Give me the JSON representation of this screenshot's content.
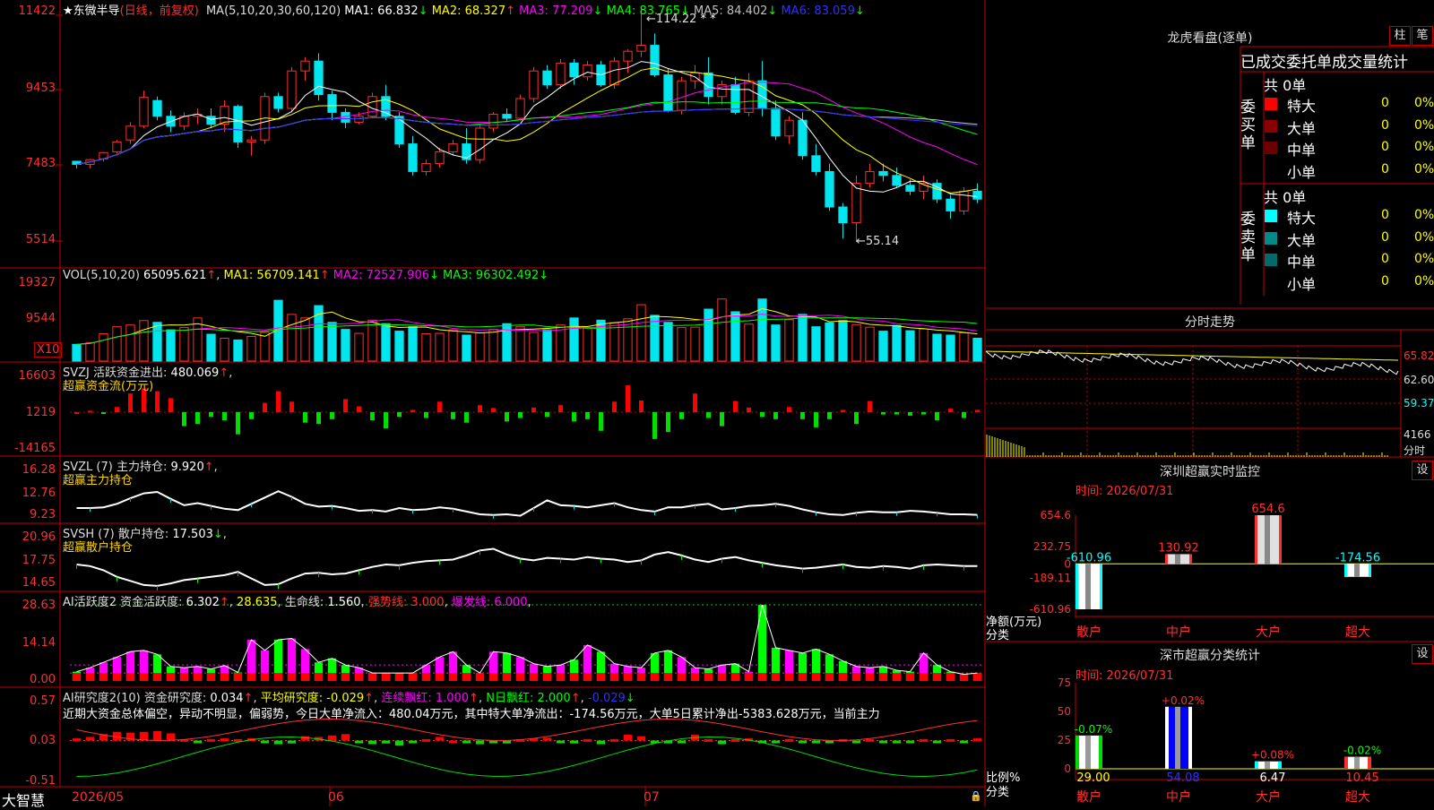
{
  "stock": {
    "star": "★",
    "name": "东微半导",
    "mode": "(日线，前复权)"
  },
  "price_panel": {
    "ma_title": "MA(5,10,20,30,60,120)",
    "ma": [
      {
        "label": "MA1:",
        "value": "66.832",
        "arrow": "↓",
        "color": "#ffffff"
      },
      {
        "label": "MA2:",
        "value": "68.327",
        "arrow": "↑",
        "color": "#ffff00"
      },
      {
        "label": "MA3:",
        "value": "77.209",
        "arrow": "↓",
        "color": "#ff00ff"
      },
      {
        "label": "MA4:",
        "value": "83.765",
        "arrow": "↓",
        "color": "#00ff00"
      },
      {
        "label": "MA5:",
        "value": "84.402",
        "arrow": "↓",
        "color": "#c0c0c0"
      },
      {
        "label": "MA6:",
        "value": "83.059",
        "arrow": "↓",
        "color": "#3030ff"
      }
    ],
    "axis": [
      "11422",
      "9453",
      "7483",
      "5514"
    ],
    "high_label": "114.22",
    "low_label": "←55.14"
  },
  "vol_panel": {
    "title": "VOL(5,10,20)",
    "value": "65095.621",
    "items": [
      {
        "label": "MA1:",
        "value": "56709.141",
        "arrow": "↑",
        "color": "#ffff00"
      },
      {
        "label": "MA2:",
        "value": "72527.906",
        "arrow": "↓",
        "color": "#ff00ff"
      },
      {
        "label": "MA3:",
        "value": "96302.492",
        "arrow": "↓",
        "color": "#00ff00"
      }
    ],
    "axis": [
      "19327",
      "9544"
    ],
    "unit": "X10"
  },
  "svzj_panel": {
    "title": "SVZJ  活跃资金进出:",
    "value": "480.069",
    "arrow": "↑",
    "subtitle": "超赢资金流(万元)",
    "axis": [
      "16603",
      "1219",
      "-14165"
    ]
  },
  "svzl_panel": {
    "title": "SVZL (7) 主力持仓:",
    "value": "9.920",
    "arrow": "↑",
    "subtitle": "超赢主力持仓",
    "axis": [
      "16.28",
      "12.76",
      "9.23"
    ]
  },
  "svsh_panel": {
    "title": "SVSH (7) 散户持仓:",
    "value": "17.503",
    "arrow": "↓",
    "subtitle": "超赢散户持仓",
    "axis": [
      "20.96",
      "17.75",
      "14.65"
    ]
  },
  "ai_active": {
    "title": "AI活跃度2 资金活跃度:",
    "v1": "6.302",
    "a1": "↑",
    "v2": "28.635",
    "life_label": "生命线:",
    "life": "1.560",
    "strong": "强势线: 3.000",
    "burst": "爆发线: 6.000",
    "axis": [
      "28.63",
      "14.14",
      "0.00"
    ]
  },
  "ai_research": {
    "title": "AI研究度2(10) 资金研究度:",
    "v1": "0.034",
    "a1": "↑",
    "avg": "平均研究度: -0.029",
    "avg_arrow": "↑",
    "red": "连续飘红: 1.000",
    "red_arrow": "↑",
    "nred": "N日飘红: 2.000",
    "nred_arrow": "↑",
    "last": "-0.029",
    "last_arrow": "↓",
    "text": "近期大资金总体偏空，异动不明显，偏弱势，今日大单净流入：480.04万元，其中特大单净流出：-174.56万元，大单5日累计净出-5383.628万元，当前主力",
    "axis": [
      "0.57",
      "0.03",
      "-0.51"
    ]
  },
  "xaxis": {
    "app": "大智慧",
    "labels": [
      "2026/05",
      "06",
      "07"
    ]
  },
  "lhb": {
    "title": "龙虎看盘(逐单)",
    "btn1": "柱",
    "btn2": "笔",
    "header": "已成交委托单成交量统计",
    "buy_label": "委买单",
    "sell_label": "委卖单",
    "buy_total": "共 0单",
    "sell_total": "共 0单",
    "buy_rows": [
      {
        "name": "特大",
        "n": "0",
        "p": "0%",
        "color": "#ff0000"
      },
      {
        "name": "大单",
        "n": "0",
        "p": "0%",
        "color": "#8b0000"
      },
      {
        "name": "中单",
        "n": "0",
        "p": "0%",
        "color": "#6b0000"
      },
      {
        "name": "小单",
        "n": "0",
        "p": "0%",
        "color": ""
      }
    ],
    "sell_rows": [
      {
        "name": "特大",
        "n": "0",
        "p": "0%",
        "color": "#00ffff"
      },
      {
        "name": "大单",
        "n": "0",
        "p": "0%",
        "color": "#008b8b"
      },
      {
        "name": "中单",
        "n": "0",
        "p": "0%",
        "color": "#006b6b"
      },
      {
        "name": "小单",
        "n": "0",
        "p": "0%",
        "color": ""
      }
    ]
  },
  "fenshi": {
    "title": "分时走势",
    "axis": [
      "65.82",
      "62.60",
      "59.37",
      "4166"
    ],
    "unit": "分时"
  },
  "sz_monitor": {
    "title": "深圳超赢实时监控",
    "setting": "设",
    "time": "时间: 2026/07/31",
    "ylabel": "净额(万元)",
    "xlabel": "分类",
    "axis": [
      "654.6",
      "232.75",
      "0",
      "-189.11",
      "-610.96"
    ],
    "categories": [
      "散户",
      "中户",
      "大户",
      "超大"
    ],
    "values": [
      -610.96,
      130.92,
      654.6,
      -174.56
    ],
    "value_labels": [
      "-610.96",
      "130.92",
      "654.6",
      "-174.56"
    ]
  },
  "sz_classify": {
    "title": "深市超赢分类统计",
    "setting": "设",
    "time": "时间: 2026/07/31",
    "ylabel": "比例%",
    "xlabel": "分类",
    "axis": [
      "75",
      "50",
      "25",
      "0"
    ],
    "categories": [
      "散户",
      "中户",
      "大户",
      "超大"
    ],
    "values": [
      29.0,
      54.08,
      6.47,
      10.45
    ],
    "value_labels": [
      "29.00",
      "54.08",
      "6.47",
      "10.45"
    ],
    "change_labels": [
      "-0.07%",
      "+0.02%",
      "+0.08%",
      "-0.02%"
    ]
  },
  "chart_data": [
    {
      "type": "candlestick",
      "title": "东微半导 (日线，前复权)",
      "ylim": [
        5514,
        11422
      ],
      "x_ticks": [
        "2026/05",
        "06",
        "07"
      ],
      "ohlc": [
        [
          7560,
          7560,
          7380,
          7480
        ],
        [
          7480,
          7620,
          7380,
          7600
        ],
        [
          7620,
          7800,
          7550,
          7780
        ],
        [
          7800,
          8100,
          7750,
          8050
        ],
        [
          8100,
          8550,
          8000,
          8450
        ],
        [
          8450,
          9350,
          8400,
          9180
        ],
        [
          9100,
          9200,
          8600,
          8700
        ],
        [
          8700,
          8850,
          8300,
          8450
        ],
        [
          8450,
          8800,
          8350,
          8700
        ],
        [
          8700,
          8900,
          8500,
          8750
        ],
        [
          8700,
          8900,
          8400,
          8500
        ],
        [
          8500,
          9100,
          8300,
          8950
        ],
        [
          8950,
          9000,
          7900,
          8050
        ],
        [
          8050,
          8200,
          7700,
          8100
        ],
        [
          8100,
          9300,
          8000,
          9200
        ],
        [
          9200,
          9300,
          8800,
          8900
        ],
        [
          8900,
          9950,
          8800,
          9850
        ],
        [
          9850,
          10200,
          9600,
          10100
        ],
        [
          10100,
          10300,
          9100,
          9250
        ],
        [
          9250,
          9350,
          8600,
          8800
        ],
        [
          8800,
          8900,
          8400,
          8550
        ],
        [
          8550,
          8800,
          8500,
          8700
        ],
        [
          8700,
          9300,
          8650,
          9200
        ],
        [
          9200,
          9500,
          8600,
          8700
        ],
        [
          8700,
          8800,
          7900,
          8000
        ],
        [
          8000,
          8200,
          7200,
          7300
        ],
        [
          7300,
          7600,
          7200,
          7500
        ],
        [
          7500,
          7900,
          7400,
          7800
        ],
        [
          7800,
          8100,
          7700,
          8000
        ],
        [
          8000,
          8400,
          7500,
          7600
        ],
        [
          7600,
          8500,
          7500,
          8400
        ],
        [
          8400,
          8800,
          8300,
          8750
        ],
        [
          8750,
          8900,
          8550,
          8650
        ],
        [
          8650,
          9250,
          8600,
          9150
        ],
        [
          9150,
          9950,
          9050,
          9850
        ],
        [
          9850,
          10000,
          9400,
          9500
        ],
        [
          9500,
          10150,
          9400,
          10050
        ],
        [
          10050,
          10150,
          9500,
          9700
        ],
        [
          9700,
          10100,
          9600,
          10000
        ],
        [
          10000,
          10100,
          9450,
          9500
        ],
        [
          9500,
          10200,
          9400,
          10100
        ],
        [
          10100,
          10400,
          9800,
          10350
        ],
        [
          10350,
          11422,
          10200,
          10500
        ],
        [
          10500,
          10800,
          9700,
          9750
        ],
        [
          9750,
          9900,
          8800,
          8850
        ],
        [
          8850,
          9700,
          8750,
          9600
        ],
        [
          9600,
          10000,
          9400,
          9800
        ],
        [
          9800,
          10200,
          9000,
          9200
        ],
        [
          9200,
          9600,
          9000,
          9500
        ],
        [
          9500,
          9700,
          8750,
          8800
        ],
        [
          8800,
          9800,
          8700,
          9600
        ],
        [
          9600,
          10100,
          8700,
          8900
        ],
        [
          8900,
          9100,
          8100,
          8200
        ],
        [
          8200,
          8700,
          8000,
          8600
        ],
        [
          8600,
          8800,
          7600,
          7700
        ],
        [
          7700,
          8000,
          7200,
          7300
        ],
        [
          7300,
          7500,
          6300,
          6400
        ],
        [
          6400,
          6500,
          5600,
          6000
        ],
        [
          6000,
          7200,
          5514,
          7000
        ],
        [
          7000,
          7500,
          6900,
          7300
        ],
        [
          7300,
          7500,
          7050,
          7200
        ],
        [
          7200,
          7400,
          6900,
          6950
        ],
        [
          6950,
          7100,
          6700,
          6800
        ],
        [
          6800,
          7200,
          6600,
          7000
        ],
        [
          7000,
          7100,
          6500,
          6600
        ],
        [
          6600,
          6700,
          6100,
          6300
        ],
        [
          6300,
          6900,
          6200,
          6800
        ],
        [
          6800,
          7000,
          6500,
          6600
        ]
      ]
    },
    {
      "type": "bar",
      "title": "VOL(5,10,20)",
      "ylim": [
        0,
        19327
      ],
      "values": [
        3800,
        4200,
        6200,
        7800,
        8200,
        9200,
        8800,
        7100,
        7600,
        9800,
        6100,
        5200,
        4800,
        5600,
        6500,
        13800,
        10600,
        9800,
        12600,
        8800,
        7200,
        6300,
        9300,
        8500,
        6800,
        7800,
        6200,
        6300,
        7100,
        5900,
        6400,
        7200,
        8500,
        7800,
        6500,
        7100,
        8200,
        9800,
        7600,
        9300,
        8700,
        9600,
        12800,
        10400,
        8800,
        7600,
        7700,
        11800,
        14100,
        11200,
        8400,
        14100,
        8200,
        9400,
        10600,
        7800,
        8700,
        9200,
        8300,
        7700,
        6800,
        8100,
        6900,
        7300,
        6100,
        5900,
        6400,
        5200
      ]
    },
    {
      "type": "bar",
      "title": "SVZJ 活跃资金进出",
      "ylim": [
        -14165,
        16603
      ],
      "values": [
        0,
        600,
        -400,
        2200,
        8000,
        10200,
        9000,
        6000,
        -6000,
        -5000,
        -2000,
        -3500,
        -9500,
        -3000,
        4000,
        9000,
        4500,
        -4500,
        -5000,
        -3000,
        5600,
        2500,
        -3500,
        -7000,
        -2000,
        1000,
        -2500,
        4500,
        -3000,
        -4500,
        3000,
        1800,
        -4000,
        -2500,
        2000,
        -2000,
        3000,
        -4000,
        -3000,
        -8000,
        4500,
        11500,
        5000,
        -11500,
        -8500,
        -3000,
        8000,
        -2500,
        -6000,
        4800,
        2000,
        -2000,
        -3000,
        2200,
        -3000,
        -6500,
        -3000,
        1000,
        -5000,
        4800,
        -1000,
        -1000,
        -1500,
        -1000,
        -3500,
        1500,
        -2500,
        1000
      ]
    },
    {
      "type": "line",
      "title": "SVZL (7) 主力持仓",
      "ylim": [
        9.23,
        16.28
      ],
      "values": [
        10.9,
        10.9,
        11.0,
        11.5,
        12.3,
        13.0,
        13.2,
        12.2,
        11.3,
        11.6,
        11.2,
        10.8,
        10.6,
        11.5,
        12.4,
        13.3,
        12.5,
        11.5,
        11.1,
        11.2,
        10.9,
        10.5,
        10.6,
        10.4,
        10.9,
        10.6,
        10.7,
        11.0,
        10.8,
        10.4,
        10.0,
        9.9,
        10.0,
        9.8,
        10.9,
        12.0,
        11.3,
        11.2,
        11.0,
        11.3,
        11.6,
        11.0,
        10.6,
        10.4,
        11.0,
        11.0,
        11.3,
        11.5,
        10.7,
        10.9,
        11.2,
        11.3,
        11.5,
        11.2,
        10.7,
        10.3,
        10.0,
        9.9,
        10.2,
        10.4,
        10.3,
        10.3,
        10.5,
        10.4,
        10.2,
        10.0,
        10.0,
        9.92
      ]
    },
    {
      "type": "line",
      "title": "SVSH (7) 散户持仓",
      "ylim": [
        14.65,
        20.96
      ],
      "values": [
        17.7,
        17.5,
        17.0,
        16.2,
        15.7,
        15.2,
        15.1,
        15.4,
        15.8,
        16.0,
        16.2,
        16.4,
        16.8,
        16.0,
        15.2,
        15.3,
        16.0,
        16.6,
        16.7,
        16.5,
        16.6,
        17.0,
        17.4,
        17.7,
        17.6,
        17.9,
        18.1,
        18.2,
        18.3,
        18.8,
        19.4,
        19.6,
        18.9,
        18.4,
        18.2,
        18.5,
        18.4,
        18.3,
        18.6,
        18.4,
        18.3,
        18.0,
        18.2,
        18.9,
        19.2,
        18.8,
        18.3,
        18.0,
        18.4,
        18.6,
        18.2,
        17.9,
        17.6,
        17.4,
        17.2,
        17.3,
        17.5,
        17.7,
        17.4,
        17.3,
        17.5,
        17.4,
        17.2,
        17.6,
        17.7,
        17.6,
        17.5,
        17.5
      ]
    },
    {
      "type": "bar",
      "title": "AI活跃度2 资金活跃度",
      "ylim": [
        0,
        28.63
      ],
      "values": [
        3.5,
        5.0,
        7.0,
        9.0,
        11.0,
        11.5,
        10.0,
        5.5,
        5.0,
        5.5,
        4.5,
        5.8,
        3.2,
        15.5,
        11.5,
        15.5,
        16.0,
        12.0,
        7.0,
        8.5,
        6.0,
        5.0,
        3.0,
        3.0,
        3.0,
        3.0,
        6.0,
        9.0,
        11.0,
        6.0,
        3.0,
        11.0,
        10.5,
        9.0,
        6.5,
        5.5,
        6.0,
        8.0,
        13.5,
        11.0,
        6.5,
        5.5,
        5.0,
        10.5,
        11.5,
        9.0,
        5.0,
        4.5,
        6.0,
        6.5,
        3.5,
        28.6,
        12.5,
        11.5,
        10.5,
        12.0,
        10.0,
        7.5,
        5.5,
        5.0,
        5.5,
        4.0,
        3.5,
        10.5,
        6.0,
        3.5,
        2.5,
        3.0
      ]
    },
    {
      "type": "bar",
      "title": "AI研究度2(10) 资金研究度",
      "ylim": [
        -0.51,
        0.57
      ],
      "values": [
        0.03,
        0.05,
        0.09,
        0.12,
        0.11,
        0.12,
        0.13,
        0.1,
        0.02,
        -0.02,
        0.02,
        0.03,
        0.02,
        0.03,
        -0.02,
        -0.05,
        -0.04,
        0.06,
        0.05,
        0.07,
        0.09,
        -0.03,
        -0.05,
        -0.04,
        -0.07,
        -0.02,
        0.02,
        0.05,
        0.0,
        -0.03,
        -0.05,
        -0.02,
        -0.04,
        0.02,
        0.03,
        0.04,
        -0.03,
        -0.04,
        0.02,
        -0.05,
        0.02,
        0.08,
        0.06,
        -0.02,
        -0.04,
        -0.02,
        0.08,
        0.02,
        -0.05,
        0.02,
        0.03,
        -0.02,
        -0.03,
        0.02,
        -0.02,
        -0.03,
        -0.02,
        0.02,
        -0.03,
        0.02,
        -0.02,
        -0.03,
        -0.02,
        0.02,
        -0.03,
        0.02,
        -0.02,
        0.03
      ]
    },
    {
      "type": "bar",
      "title": "深圳超赢实时监控",
      "categories": [
        "散户",
        "中户",
        "大户",
        "超大"
      ],
      "values": [
        -610.96,
        130.92,
        654.6,
        -174.56
      ],
      "ylim": [
        -610.96,
        654.6
      ]
    },
    {
      "type": "bar",
      "title": "深市超赢分类统计",
      "categories": [
        "散户",
        "中户",
        "大户",
        "超大"
      ],
      "values": [
        29.0,
        54.08,
        6.47,
        10.45
      ],
      "ylim": [
        0,
        75
      ]
    }
  ]
}
